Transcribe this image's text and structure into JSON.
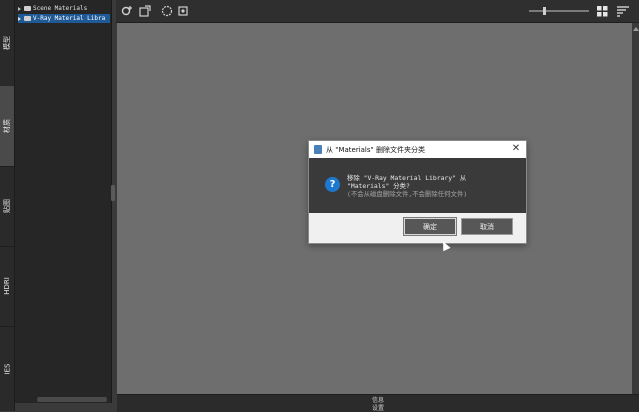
{
  "left_tabs": [
    {
      "label": "模型",
      "active": false
    },
    {
      "label": "材质",
      "active": true
    },
    {
      "label": "贴图",
      "active": false
    },
    {
      "label": "HDRI",
      "active": false
    },
    {
      "label": "IES",
      "active": false
    }
  ],
  "tree": {
    "items": [
      {
        "label": "Scene Materials",
        "selected": false
      },
      {
        "label": "V-Ray Material Libra",
        "selected": true
      }
    ]
  },
  "toolbar": {
    "icons": [
      "add-material-icon",
      "import-icon",
      "palette-icon",
      "settings-icon"
    ],
    "view_icons": [
      "grid-view-icon",
      "sort-icon"
    ],
    "thumbnail_size": 0.25
  },
  "bottom": {
    "info_label": "信息",
    "settings_label": "设置"
  },
  "dialog": {
    "title": "从 \"Materials\" 删除文件夹分类",
    "line1": "移除 \"V-Ray Material Library\" 从",
    "line2": "\"Materials\" 分类?",
    "line3": "(不会从磁盘删除文件,不会删除任何文件)",
    "ok_label": "确定",
    "cancel_label": "取消",
    "close_glyph": "✕",
    "question_glyph": "?"
  },
  "colors": {
    "accent": "#1f5a96",
    "question_icon": "#1d79d0",
    "canvas": "#6e6e6e"
  }
}
